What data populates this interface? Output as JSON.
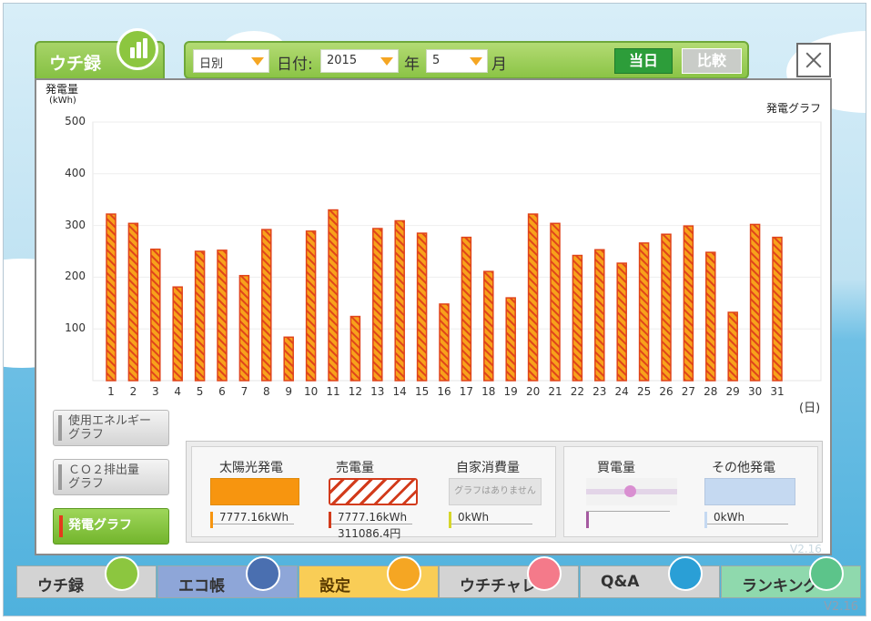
{
  "tab": {
    "title": "ウチ録"
  },
  "toolbar": {
    "mode_value": "日別",
    "date_label": "日付:",
    "year_value": "2015",
    "year_unit": "年",
    "month_value": "5",
    "month_unit": "月",
    "today_button": "当日",
    "compare_button": "比較"
  },
  "side_buttons": {
    "energy": [
      "使用エネルギー",
      "グラフ"
    ],
    "co2": [
      "ＣＯ２排出量",
      "グラフ"
    ],
    "generation": "発電グラフ"
  },
  "legend": {
    "solar": {
      "label": "太陽光発電",
      "value": "7777.16kWh"
    },
    "sold": {
      "label": "売電量",
      "value": "7777.16kWh",
      "sub": "311086.4円"
    },
    "self": {
      "label": "自家消費量",
      "note": "グラフはありません",
      "value": "0kWh"
    },
    "bought": {
      "label": "買電量",
      "value": ""
    },
    "other": {
      "label": "その他発電",
      "value": "0kWh"
    }
  },
  "nav": [
    {
      "label": "ウチ録",
      "icon": "bar-chart-icon",
      "color": "#8cc63f"
    },
    {
      "label": "エコ帳",
      "icon": "notebook-icon",
      "color": "#4a6fb0"
    },
    {
      "label": "設定",
      "icon": "wrench-icon",
      "color": "#f5a623"
    },
    {
      "label": "ウチチャレ",
      "icon": "flag-icon",
      "color": "#f47a8a"
    },
    {
      "label": "Q&A",
      "icon": "question-icon",
      "color": "#2a9fd6"
    },
    {
      "label": "ランキング",
      "icon": "crown-icon",
      "color": "#5cc48a"
    }
  ],
  "version": "V2.16",
  "colors": {
    "bar_fill": "#f7a21b",
    "bar_stripe": "#e0441b",
    "accent_green": "#8cc63f"
  },
  "chart_data": {
    "type": "bar",
    "title": "発電グラフ",
    "ylabel": "発電量",
    "yunit": "(kWh)",
    "xunit": "(日)",
    "ylim": [
      0,
      500
    ],
    "yticks": [
      100,
      200,
      300,
      400,
      500
    ],
    "categories": [
      "1",
      "2",
      "3",
      "4",
      "5",
      "6",
      "7",
      "8",
      "9",
      "10",
      "11",
      "12",
      "13",
      "14",
      "15",
      "16",
      "17",
      "18",
      "19",
      "20",
      "21",
      "22",
      "23",
      "24",
      "25",
      "26",
      "27",
      "28",
      "29",
      "30",
      "31"
    ],
    "values": [
      322,
      304,
      254,
      181,
      250,
      252,
      203,
      292,
      84,
      289,
      330,
      124,
      294,
      309,
      285,
      148,
      277,
      211,
      160,
      322,
      304,
      242,
      253,
      227,
      266,
      283,
      299,
      248,
      132,
      302,
      277
    ],
    "grid": true
  }
}
